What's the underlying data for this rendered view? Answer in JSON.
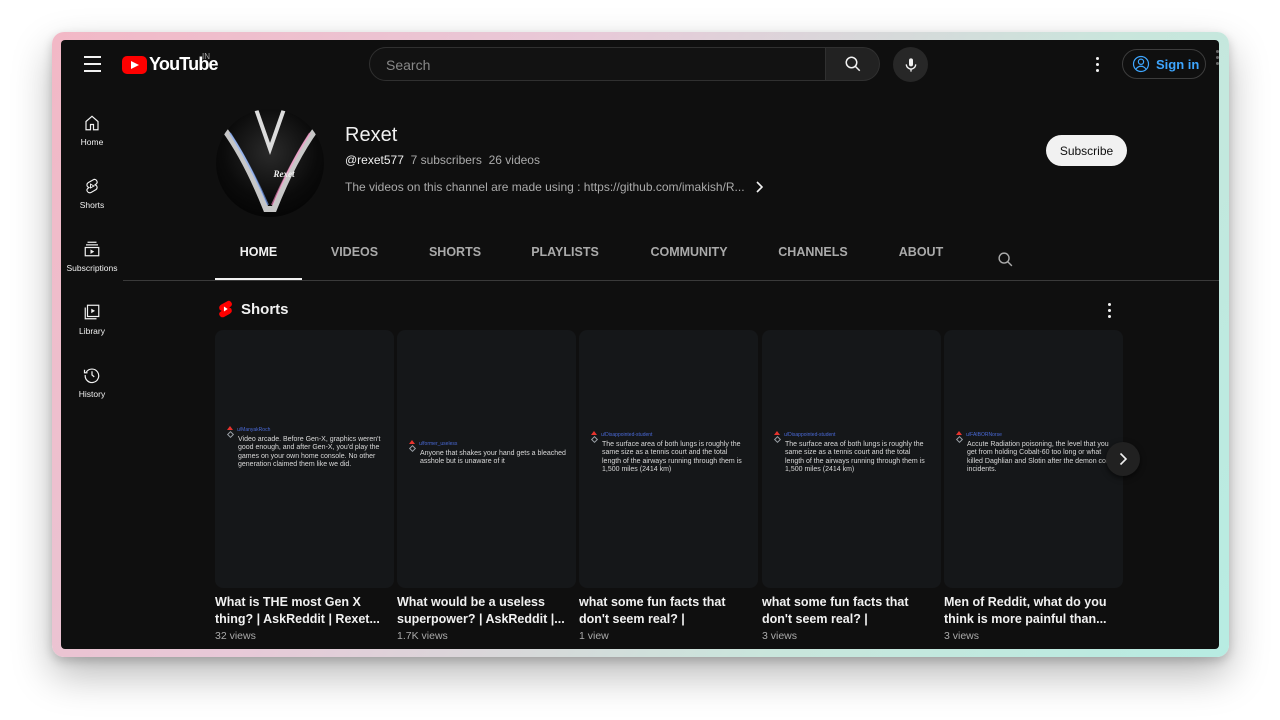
{
  "header": {
    "logo_text": "YouTube",
    "region": "IN",
    "search_placeholder": "Search",
    "signin_label": "Sign in"
  },
  "sidebar": {
    "items": [
      {
        "label": "Home",
        "icon": "home-icon"
      },
      {
        "label": "Shorts",
        "icon": "shorts-icon"
      },
      {
        "label": "Subscriptions",
        "icon": "subscriptions-icon"
      },
      {
        "label": "Library",
        "icon": "library-icon"
      },
      {
        "label": "History",
        "icon": "history-icon"
      }
    ]
  },
  "channel": {
    "name": "Rexet",
    "avatar_text": "Rexet",
    "handle": "@rexet577",
    "subscribers": "7 subscribers",
    "videos": "26 videos",
    "description": "The videos on this channel are made using : https://github.com/imakish/R...",
    "subscribe_label": "Subscribe"
  },
  "tabs": [
    "HOME",
    "VIDEOS",
    "SHORTS",
    "PLAYLISTS",
    "COMMUNITY",
    "CHANNELS",
    "ABOUT"
  ],
  "active_tab": "HOME",
  "shorts": {
    "section_title": "Shorts",
    "items": [
      {
        "thumb_user": "u/ManyakRoch",
        "thumb_text": "Video arcade. Before Gen-X, graphics weren't good enough, and after Gen-X, you'd play the games on your own home console. No other generation claimed them like we did.",
        "title": "What is THE most Gen X thing? | AskReddit | Rexet...",
        "views": "32 views"
      },
      {
        "thumb_user": "u/former_useless",
        "thumb_text": "Anyone that shakes your hand gets a bleached asshole but is unaware of it",
        "title": "What would be a useless superpower? | AskReddit |...",
        "views": "1.7K views"
      },
      {
        "thumb_user": "u/Disappointed-student",
        "thumb_text": "The surface area of both lungs is roughly the same size as a tennis court and the total length of the airways running through them is 1,500 miles (2414 km)",
        "title": "what some fun facts that don't seem real? | AskReddi...",
        "views": "1 view"
      },
      {
        "thumb_user": "u/Disappointed-student",
        "thumb_text": "The surface area of both lungs is roughly the same size as a tennis court and the total length of the airways running through them is 1,500 miles (2414 km)",
        "title": "what some fun facts that don't seem real? | AskReddi...",
        "views": "3 views"
      },
      {
        "thumb_user": "u/FAIBORNorse",
        "thumb_text": "Accute Radiation poisoning, the level that you get from holding Cobalt-60 too long or what killed Daghlian and Slotin after the demon core incidents.",
        "title": "Men of Reddit, what do you think is more painful than...",
        "views": "3 views"
      }
    ]
  },
  "colors": {
    "background": "#0f0f0f",
    "accent_red": "#ff0000",
    "link_blue": "#3ea6ff"
  }
}
